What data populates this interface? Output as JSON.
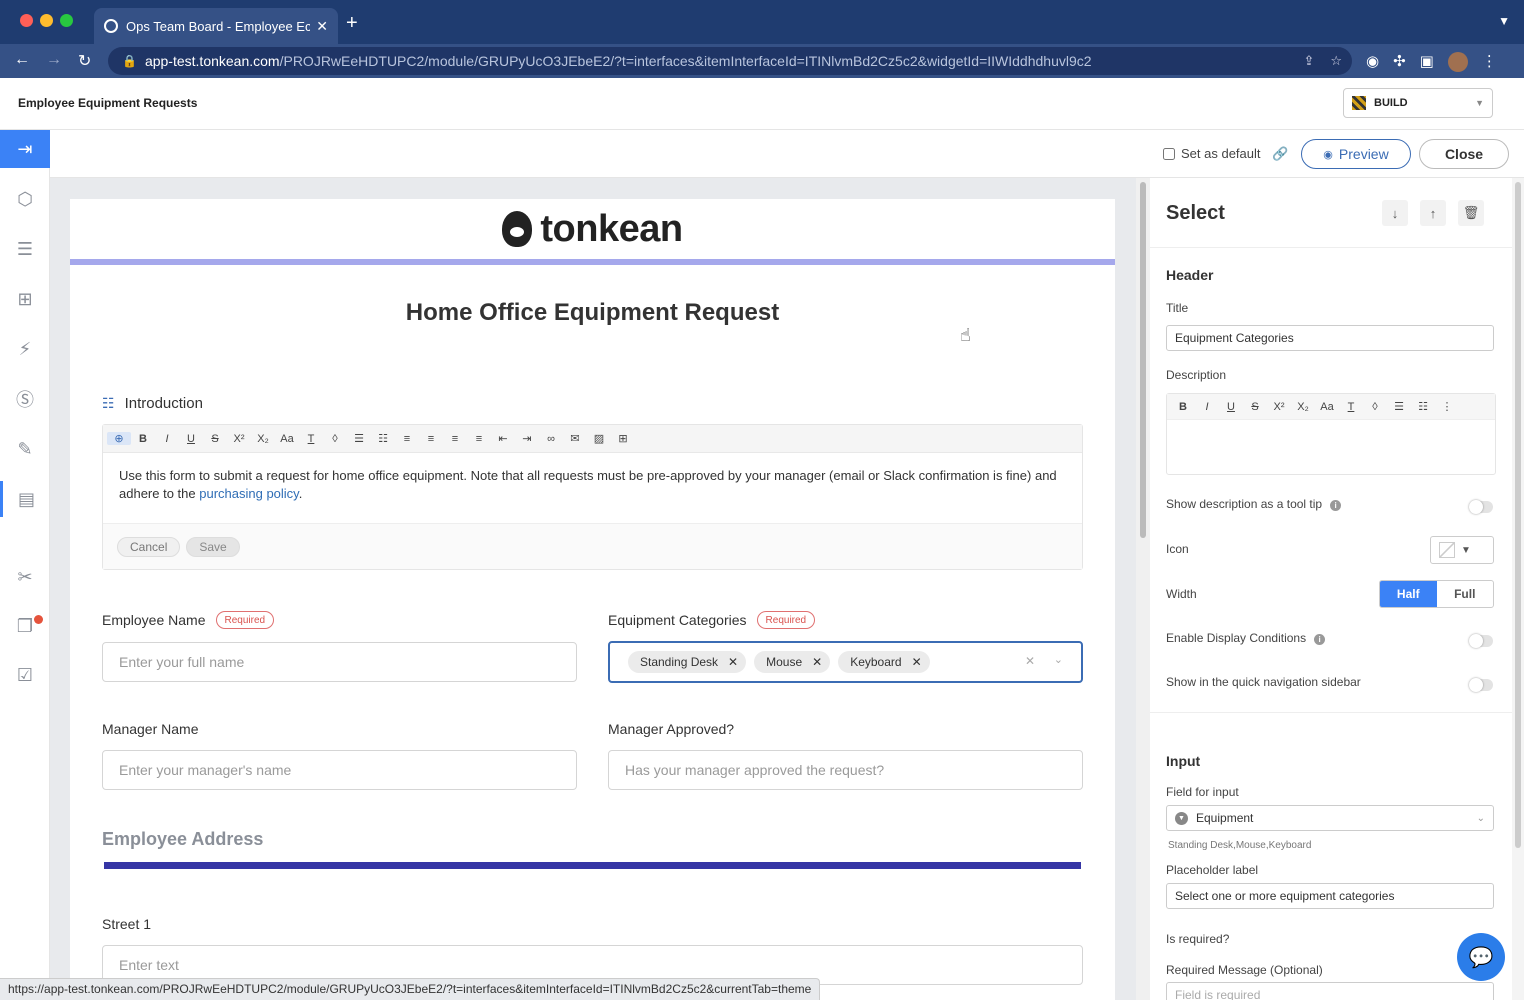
{
  "browser": {
    "tab_title": "Ops Team Board - Employee Ec",
    "url_host": "app-test.tonkean.com",
    "url_path": "/PROJRwEeHDTUPC2/module/GRUPyUcO3JEbeE2/?t=interfaces&itemInterfaceId=ITINlvmBd2Cz5c2&widgetId=IIWIddhdhuvl9c2",
    "status_url": "https://app-test.tonkean.com/PROJRwEeHDTUPC2/module/GRUPyUcO3JEbeE2/?t=interfaces&itemInterfaceId=ITINlvmBd2Cz5c2&currentTab=theme"
  },
  "app": {
    "title": "Employee Equipment Requests",
    "mode": "BUILD"
  },
  "subheader": {
    "set_default_label": "Set as default",
    "preview_label": "Preview",
    "close_label": "Close"
  },
  "form": {
    "logo_text": "tonkean",
    "title": "Home Office Equipment Request",
    "intro_label": "Introduction",
    "intro_text": "Use this form to submit a request for home office equipment. Note that all requests must be pre-approved by your manager (email or Slack confirmation is fine) and adhere to the ",
    "intro_link": "purchasing policy",
    "intro_end": ".",
    "cancel_label": "Cancel",
    "save_label": "Save",
    "required_label": "Required",
    "employee_name_label": "Employee Name",
    "employee_name_placeholder": "Enter your full name",
    "equipment_label": "Equipment Categories",
    "equipment_chips": [
      "Standing Desk",
      "Mouse",
      "Keyboard"
    ],
    "manager_name_label": "Manager Name",
    "manager_name_placeholder": "Enter your manager's name",
    "manager_approved_label": "Manager Approved?",
    "manager_approved_placeholder": "Has your manager approved the request?",
    "address_section": "Employee Address",
    "street1_label": "Street 1",
    "street1_placeholder": "Enter text"
  },
  "panel": {
    "title": "Select",
    "header_section": "Header",
    "title_label": "Title",
    "title_value": "Equipment Categories",
    "description_label": "Description",
    "tooltip_label": "Show description as a tool tip",
    "icon_label": "Icon",
    "width_label": "Width",
    "width_half": "Half",
    "width_full": "Full",
    "display_conditions_label": "Enable Display Conditions",
    "quick_nav_label": "Show in the quick navigation sidebar",
    "input_section": "Input",
    "field_for_input_label": "Field for input",
    "field_for_input_value": "Equipment",
    "field_hint": "Standing Desk,Mouse,Keyboard",
    "placeholder_label": "Placeholder label",
    "placeholder_value": "Select one or more equipment categories",
    "is_required_label": "Is required?",
    "required_message_label": "Required Message (Optional)",
    "required_message_placeholder": "Field is required"
  },
  "colors": {
    "accent": "#3b82f6",
    "browser_chrome": "#1f3c70",
    "section_bar": "#3535a5",
    "required_red": "#d9534f"
  }
}
